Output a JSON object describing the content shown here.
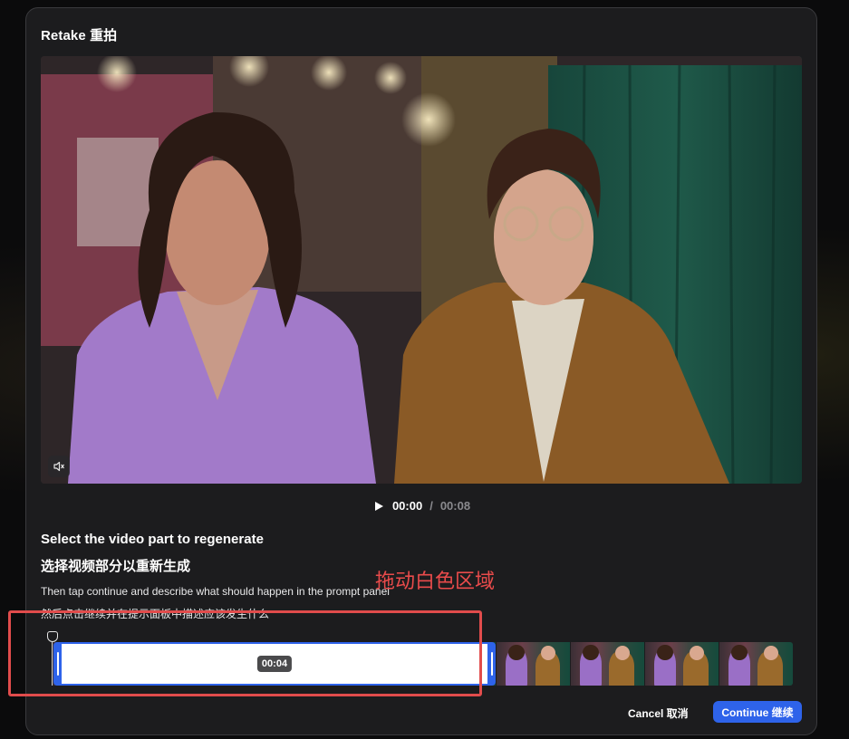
{
  "modal": {
    "title": "Retake 重拍"
  },
  "video": {
    "mute_icon": "speaker-muted-icon"
  },
  "playback": {
    "play_icon": "play-icon",
    "current_time": "00:00",
    "separator": "/",
    "total_time": "00:08"
  },
  "instructions": {
    "title": "Select the video part to regenerate",
    "title_cn": "选择视频部分以重新生成",
    "body": "Then tap continue and describe what should happen in the prompt panel",
    "body_cn": "然后点击继续并在提示面板中描述应该发生什么"
  },
  "annotation": {
    "text": "拖动白色区域"
  },
  "timeline": {
    "selection_duration": "00:04",
    "thumbnail_count": 10
  },
  "footer": {
    "cancel_label": "Cancel 取消",
    "continue_label": "Continue 继续"
  },
  "colors": {
    "accent": "#2e63ea",
    "annotation_red": "#e14c4c",
    "panel": "#1c1c1e"
  }
}
